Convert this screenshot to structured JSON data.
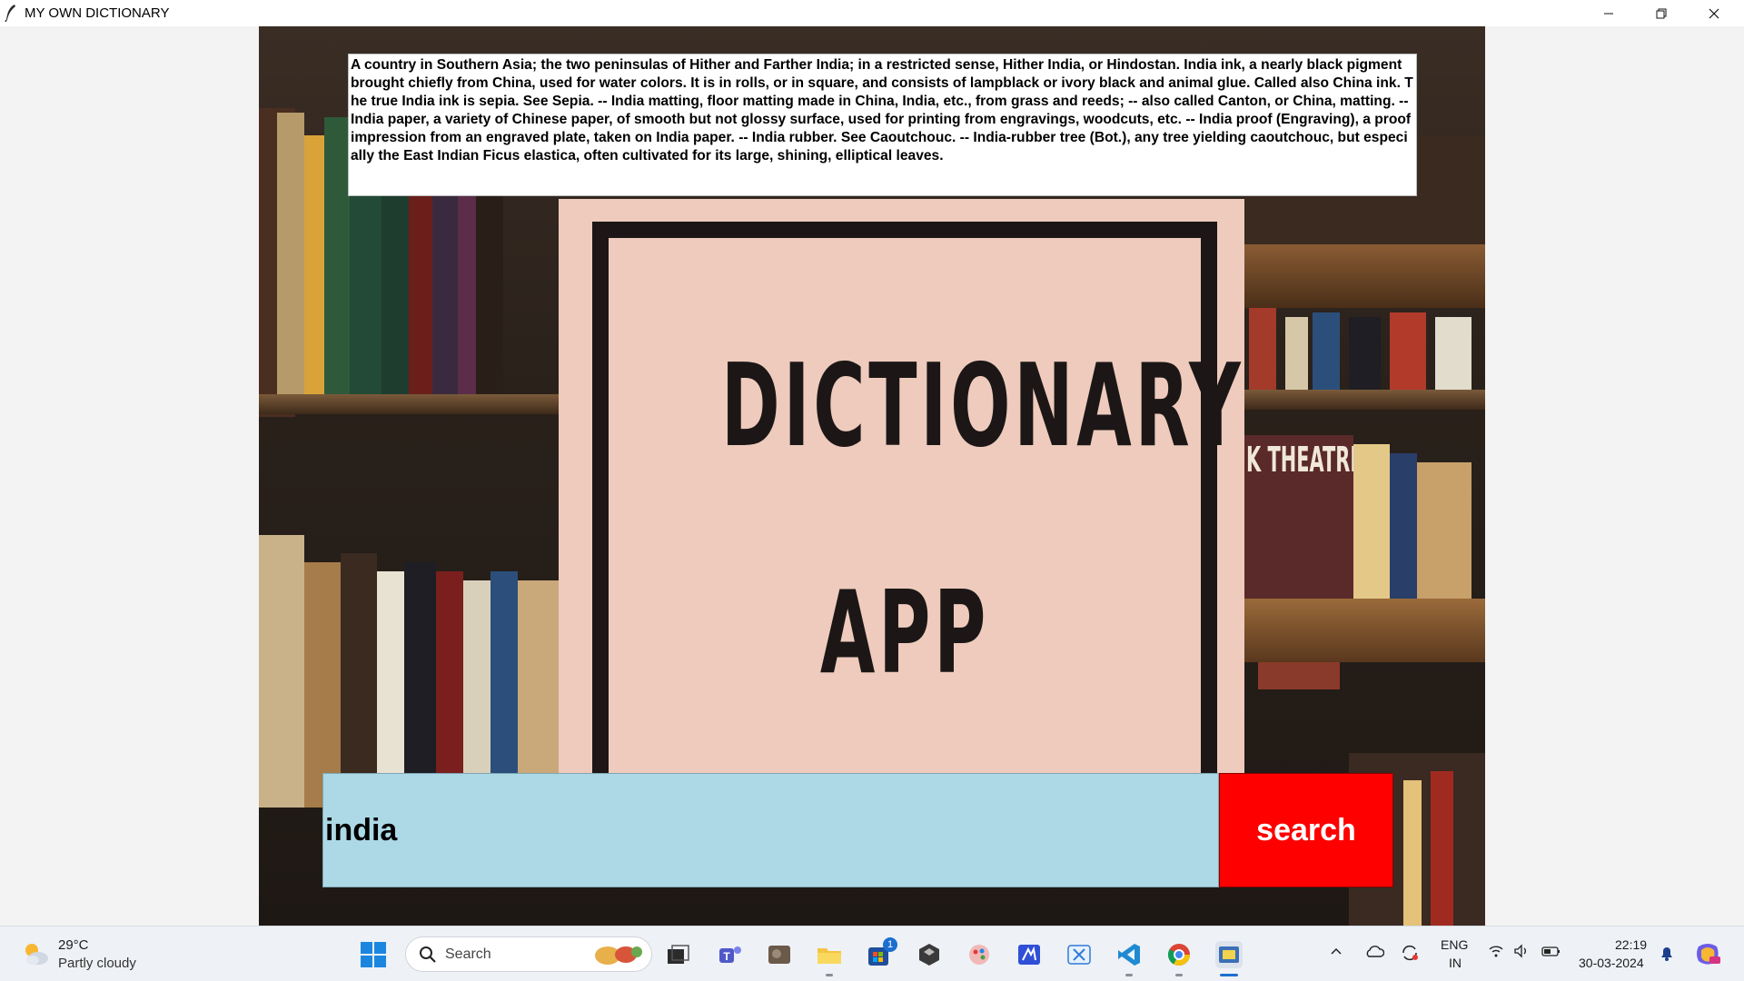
{
  "window": {
    "title": "MY OWN DICTIONARY",
    "controls": {
      "minimize": "minimize-icon",
      "maximize": "restore-icon",
      "close": "close-icon"
    }
  },
  "app": {
    "definition": "A country in Southern Asia; the two peninsulas of Hither and Farther India; in a restricted sense, Hither India, or Hindostan. India ink, a nearly black pigment brought chiefly from China, used for water colors. It is in rolls, or in square, and consists of lampblack or ivory black and animal glue. Called also China ink. The true India ink is sepia. See Sepia. -- India matting, floor matting made in China, India, etc., from grass and reeds; -- also called Canton, or China, matting. -- India paper, a variety of Chinese paper, of smooth but not glossy surface, used for printing from engravings, woodcuts, etc. -- India proof (Engraving), a proof impression from an engraved plate, taken on India paper. -- India rubber. See Caoutchouc. -- India-rubber tree (Bot.), any tree yielding caoutchouc, but especially the East Indian Ficus elastica, often cultivated for its large, shining, elliptical leaves.",
    "poster_line1": "DICTIONARY",
    "poster_line2": "APP",
    "background_text": "K THEATRE",
    "search_value": "india",
    "search_button": "search",
    "colors": {
      "entry_bg": "#add8e6",
      "button_bg": "#ff0000",
      "poster_bg": "#eecbbd"
    }
  },
  "taskbar": {
    "weather_temp": "29°C",
    "weather_desc": "Partly cloudy",
    "search_label": "Search",
    "store_badge": "1",
    "lang_top": "ENG",
    "lang_bottom": "IN",
    "time": "22:19",
    "date": "30-03-2024"
  }
}
